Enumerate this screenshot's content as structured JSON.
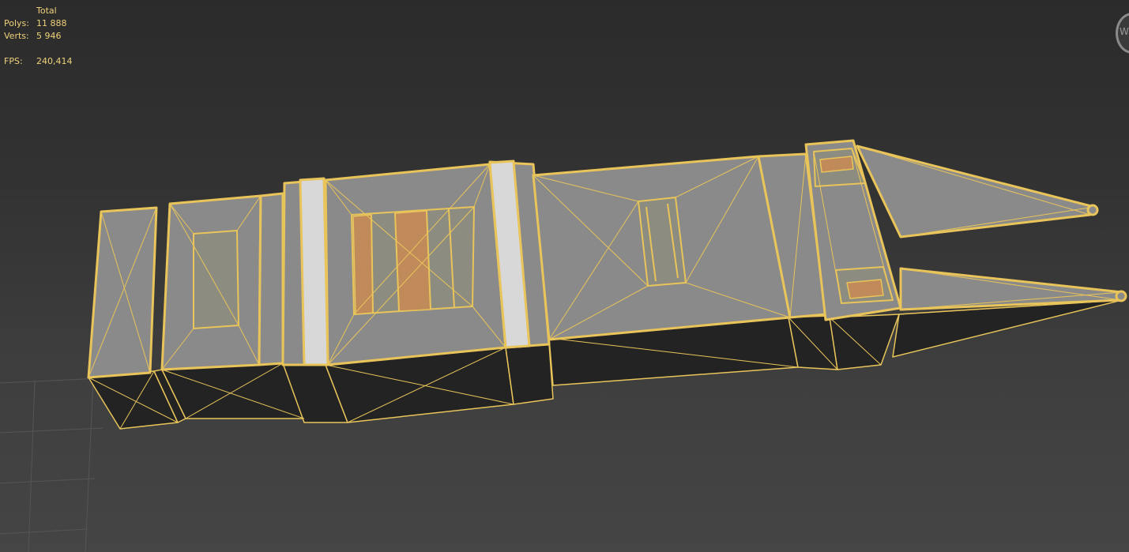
{
  "viewport_stats": {
    "header": "Total",
    "polys_label": "Polys:",
    "polys_value": "11 888",
    "verts_label": "Verts:",
    "verts_value": "5 946",
    "fps_label": "FPS:",
    "fps_value": "240,414"
  },
  "colors": {
    "stats_text": "#f0d27a",
    "selection_wire": "#e8c45a",
    "mesh_top": "#8a8a8a",
    "mesh_side": "#242424",
    "highlight_white": "#d8d8d8",
    "highlight_orange": "#c08a5a",
    "grid_line": "#555555"
  },
  "icons": {
    "viewcube": "viewcube-compass-icon"
  }
}
